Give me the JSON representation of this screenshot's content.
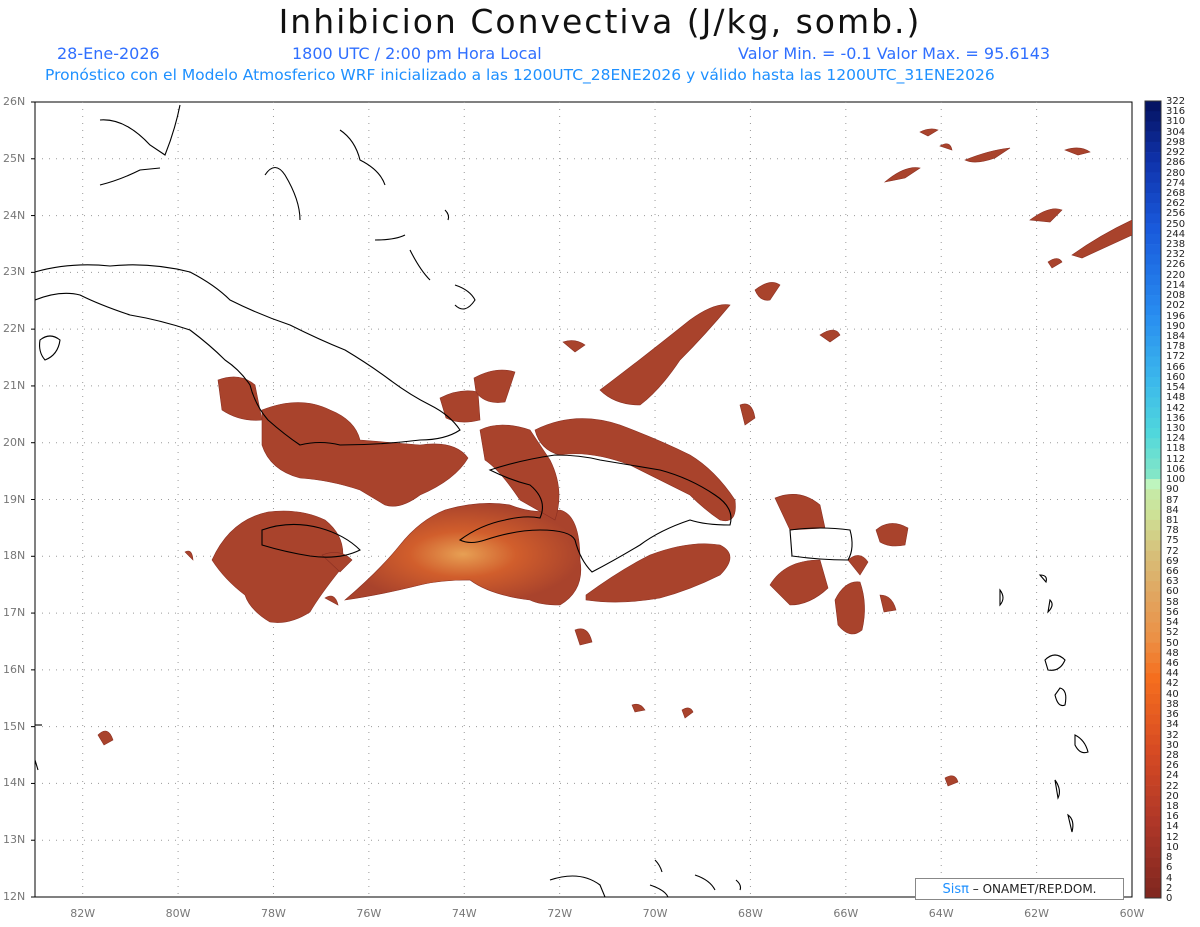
{
  "header": {
    "title": "Inhibicion Convectiva (J/kg, somb.)",
    "date": "28-Ene-2026",
    "time": "1800 UTC / 2:00 pm Hora Local",
    "minmax": "Valor Min. = -0.1  Valor Max. = 95.6143",
    "model": "Pronóstico con el Modelo Atmosferico WRF inicializado a las 1200UTC_28ENE2026 y válido hasta las  1200UTC_31ENE2026"
  },
  "axes": {
    "lat_labels": [
      "26N",
      "25N",
      "24N",
      "23N",
      "22N",
      "21N",
      "20N",
      "19N",
      "18N",
      "17N",
      "16N",
      "15N",
      "14N",
      "13N",
      "12N"
    ],
    "lon_labels": [
      "82W",
      "80W",
      "78W",
      "76W",
      "74W",
      "72W",
      "70W",
      "68W",
      "66W",
      "64W",
      "62W",
      "60W"
    ]
  },
  "colorbar": {
    "labels": [
      "322",
      "316",
      "310",
      "304",
      "298",
      "292",
      "286",
      "280",
      "274",
      "268",
      "262",
      "256",
      "250",
      "244",
      "238",
      "232",
      "226",
      "220",
      "214",
      "208",
      "202",
      "196",
      "190",
      "184",
      "178",
      "172",
      "166",
      "160",
      "154",
      "148",
      "142",
      "136",
      "130",
      "124",
      "118",
      "112",
      "106",
      "100",
      "90",
      "87",
      "84",
      "81",
      "78",
      "75",
      "72",
      "69",
      "66",
      "63",
      "60",
      "58",
      "56",
      "54",
      "52",
      "50",
      "48",
      "46",
      "44",
      "42",
      "40",
      "38",
      "36",
      "34",
      "32",
      "30",
      "28",
      "26",
      "24",
      "22",
      "20",
      "18",
      "16",
      "14",
      "12",
      "10",
      "8",
      "6",
      "4",
      "2",
      "0"
    ]
  },
  "credit": {
    "brand": "Sisπ",
    "text": "– ONAMET/REP.DOM."
  },
  "colors": {
    "shade": "#a9432c",
    "shade_hot": "#d9662e",
    "coast": "#000000",
    "grid": "#9a9a9a"
  }
}
